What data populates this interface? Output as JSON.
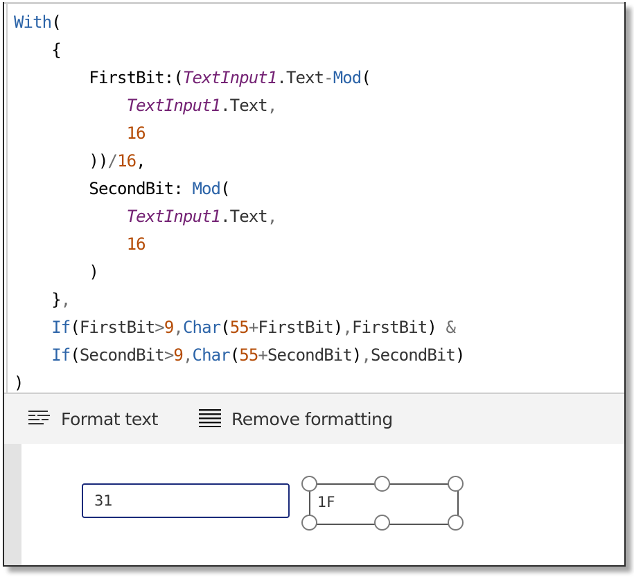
{
  "editor": {
    "lines": [
      [
        [
          "kw",
          "With"
        ],
        [
          "p",
          "("
        ]
      ],
      [
        [
          "p",
          "    {"
        ]
      ],
      [
        [
          "p",
          "        FirstBit:("
        ],
        [
          "ctl",
          "TextInput1"
        ],
        [
          "prop",
          ".Text"
        ],
        [
          "op",
          "-"
        ],
        [
          "kw",
          "Mod"
        ],
        [
          "p",
          "("
        ]
      ],
      [
        [
          "p",
          "            "
        ],
        [
          "ctl",
          "TextInput1"
        ],
        [
          "prop",
          ".Text"
        ],
        [
          "op",
          ","
        ]
      ],
      [
        [
          "p",
          "            "
        ],
        [
          "num",
          "16"
        ]
      ],
      [
        [
          "p",
          "        ))"
        ],
        [
          "op",
          "/"
        ],
        [
          "num",
          "16"
        ],
        [
          "p",
          ","
        ]
      ],
      [
        [
          "p",
          "        SecondBit: "
        ],
        [
          "kw",
          "Mod"
        ],
        [
          "p",
          "("
        ]
      ],
      [
        [
          "p",
          "            "
        ],
        [
          "ctl",
          "TextInput1"
        ],
        [
          "prop",
          ".Text"
        ],
        [
          "op",
          ","
        ]
      ],
      [
        [
          "p",
          "            "
        ],
        [
          "num",
          "16"
        ]
      ],
      [
        [
          "p",
          "        )"
        ]
      ],
      [
        [
          "p",
          "    }"
        ],
        [
          "op",
          ","
        ]
      ],
      [
        [
          "p",
          "    "
        ],
        [
          "kw",
          "If"
        ],
        [
          "p",
          "("
        ],
        [
          "id",
          "FirstBit"
        ],
        [
          "op",
          ">"
        ],
        [
          "num",
          "9"
        ],
        [
          "op",
          ","
        ],
        [
          "kw",
          "Char"
        ],
        [
          "p",
          "("
        ],
        [
          "num",
          "55"
        ],
        [
          "op",
          "+"
        ],
        [
          "id",
          "FirstBit"
        ],
        [
          "p",
          ")"
        ],
        [
          "op",
          ","
        ],
        [
          "id",
          "FirstBit"
        ],
        [
          "p",
          ") "
        ],
        [
          "op",
          "&"
        ]
      ],
      [
        [
          "p",
          "    "
        ],
        [
          "kw",
          "If"
        ],
        [
          "p",
          "("
        ],
        [
          "id",
          "SecondBit"
        ],
        [
          "op",
          ">"
        ],
        [
          "num",
          "9"
        ],
        [
          "op",
          ","
        ],
        [
          "kw",
          "Char"
        ],
        [
          "p",
          "("
        ],
        [
          "num",
          "55"
        ],
        [
          "op",
          "+"
        ],
        [
          "id",
          "SecondBit"
        ],
        [
          "p",
          ")"
        ],
        [
          "op",
          ","
        ],
        [
          "id",
          "SecondBit"
        ],
        [
          "p",
          ")"
        ]
      ],
      [
        [
          "p",
          ")"
        ]
      ]
    ]
  },
  "toolbar": {
    "format_text": {
      "label": "Format text",
      "icon": "format-text-icon"
    },
    "remove_formatting": {
      "label": "Remove formatting",
      "icon": "remove-formatting-icon"
    }
  },
  "canvas": {
    "text_input": {
      "value": "31"
    },
    "label": {
      "text": "1F",
      "selected": true
    }
  },
  "colors": {
    "keyword": "#2c64a8",
    "control": "#742274",
    "number": "#b54c06",
    "input_border": "#1a2a7a"
  }
}
